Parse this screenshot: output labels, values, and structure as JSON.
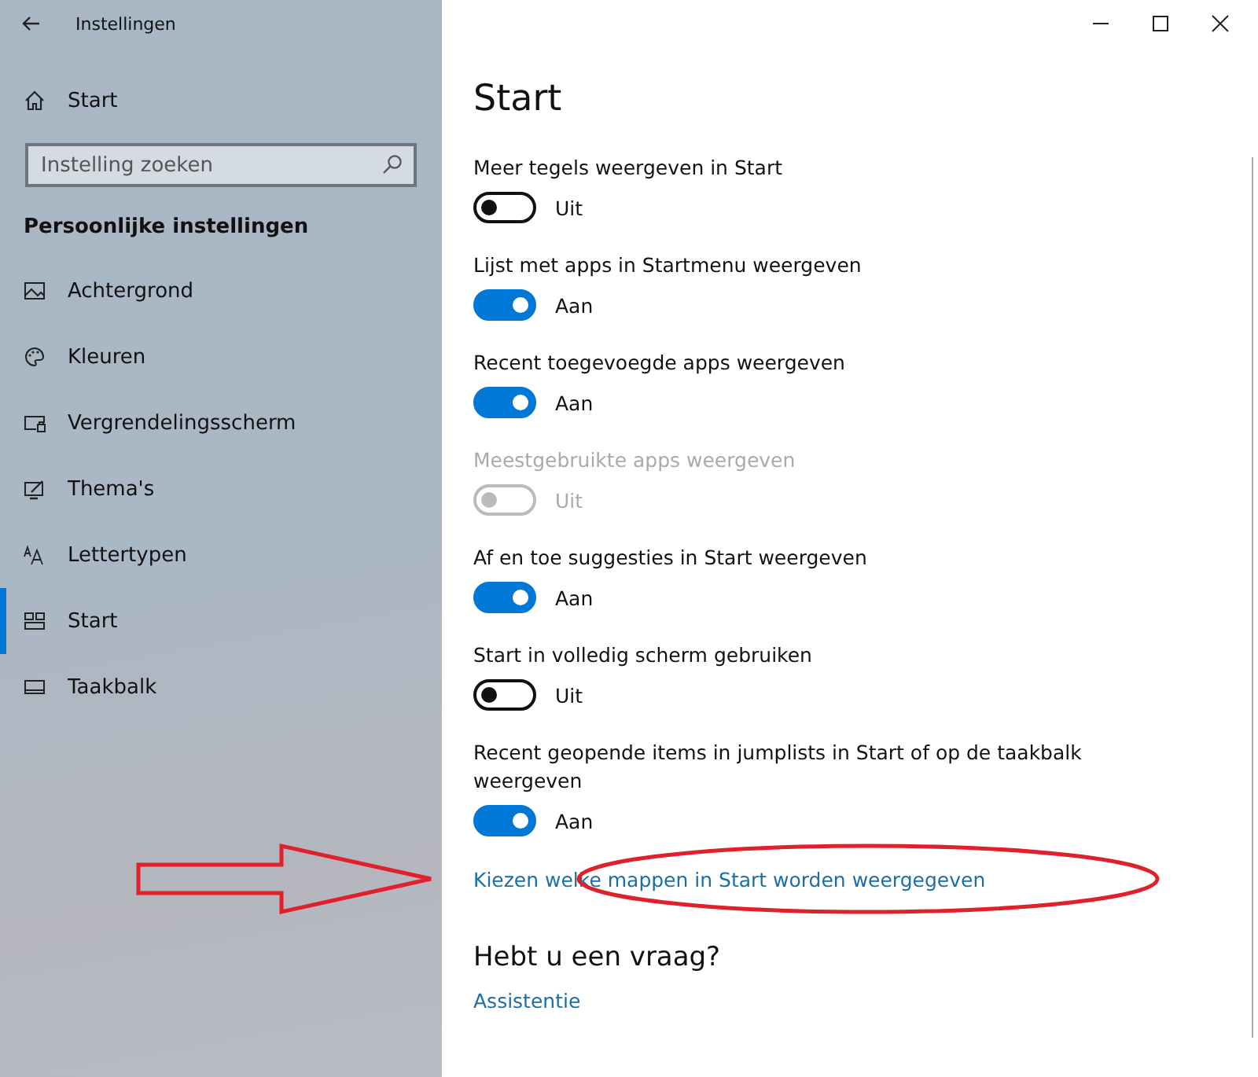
{
  "window": {
    "title": "Instellingen"
  },
  "sidebar": {
    "home": "Start",
    "search": {
      "placeholder": "Instelling zoeken"
    },
    "heading": "Persoonlijke instellingen",
    "items": [
      {
        "label": "Achtergrond",
        "selected": false
      },
      {
        "label": "Kleuren",
        "selected": false
      },
      {
        "label": "Vergrendelingsscherm",
        "selected": false
      },
      {
        "label": "Thema's",
        "selected": false
      },
      {
        "label": "Lettertypen",
        "selected": false
      },
      {
        "label": "Start",
        "selected": true
      },
      {
        "label": "Taakbalk",
        "selected": false
      }
    ]
  },
  "page": {
    "title": "Start",
    "settings": [
      {
        "label": "Meer tegels weergeven in Start",
        "on": false,
        "disabled": false,
        "state_text": "Uit"
      },
      {
        "label": "Lijst met apps in Startmenu weergeven",
        "on": true,
        "disabled": false,
        "state_text": "Aan"
      },
      {
        "label": "Recent toegevoegde apps weergeven",
        "on": true,
        "disabled": false,
        "state_text": "Aan"
      },
      {
        "label": "Meestgebruikte apps weergeven",
        "on": false,
        "disabled": true,
        "state_text": "Uit"
      },
      {
        "label": "Af en toe suggesties in Start weergeven",
        "on": true,
        "disabled": false,
        "state_text": "Aan"
      },
      {
        "label": "Start in volledig scherm gebruiken",
        "on": false,
        "disabled": false,
        "state_text": "Uit"
      },
      {
        "label": "Recent geopende items in jumplists in Start of op de taakbalk weergeven",
        "on": true,
        "disabled": false,
        "state_text": "Aan"
      }
    ],
    "link": "Kiezen welke mappen in Start worden weergegeven",
    "help": {
      "heading": "Hebt u een vraag?",
      "link": "Assistentie"
    }
  }
}
